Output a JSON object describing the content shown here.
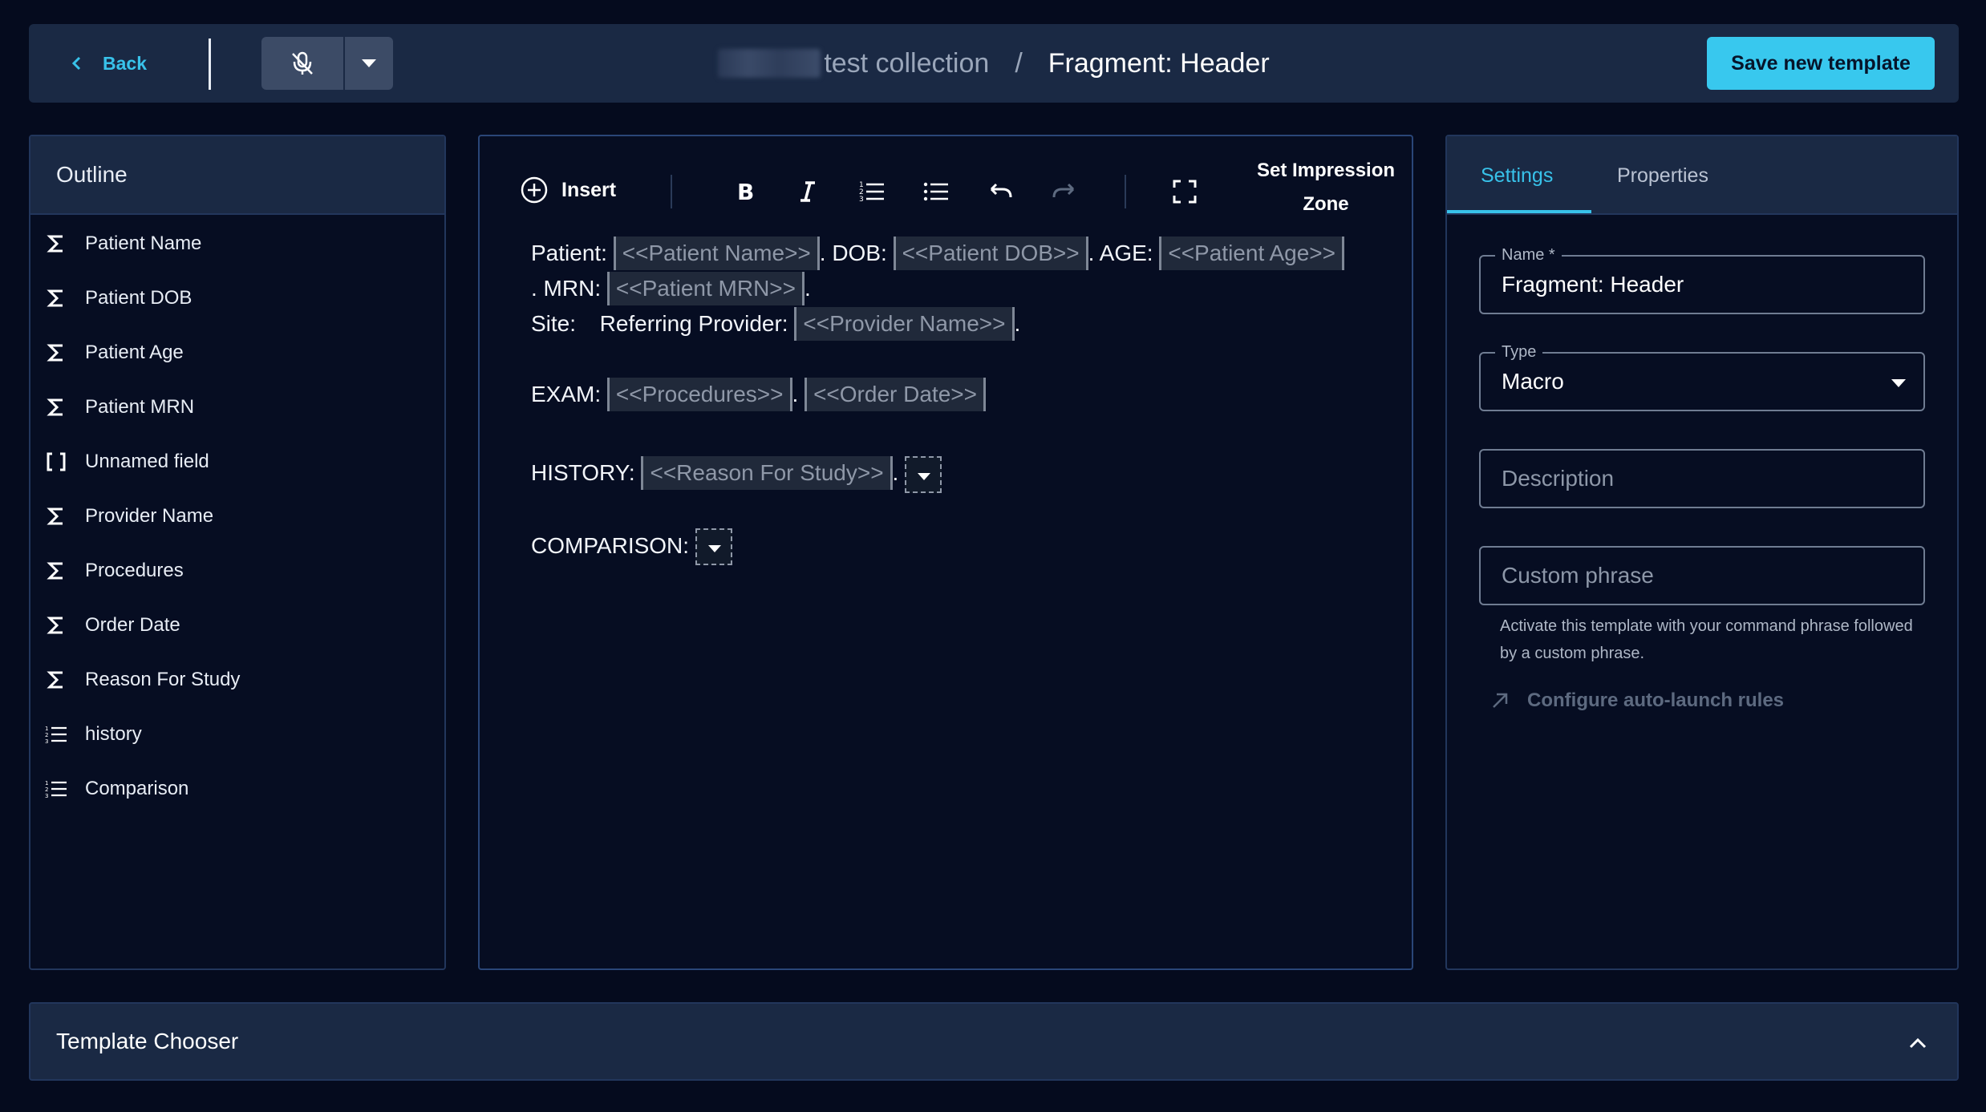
{
  "header": {
    "back_label": "Back",
    "collection": "test collection",
    "separator": "/",
    "current": "Fragment: Header",
    "save_label": "Save new template"
  },
  "outline": {
    "title": "Outline",
    "items": [
      {
        "label": "Patient Name",
        "icon": "sigma-icon"
      },
      {
        "label": "Patient DOB",
        "icon": "sigma-icon"
      },
      {
        "label": "Patient Age",
        "icon": "sigma-icon"
      },
      {
        "label": "Patient MRN",
        "icon": "sigma-icon"
      },
      {
        "label": "Unnamed field",
        "icon": "brackets-icon"
      },
      {
        "label": "Provider Name",
        "icon": "sigma-icon"
      },
      {
        "label": "Procedures",
        "icon": "sigma-icon"
      },
      {
        "label": "Order Date",
        "icon": "sigma-icon"
      },
      {
        "label": "Reason For Study",
        "icon": "sigma-icon"
      },
      {
        "label": "history",
        "icon": "list-icon"
      },
      {
        "label": "Comparison",
        "icon": "list-icon"
      }
    ]
  },
  "editor": {
    "insert_label": "Insert",
    "impression_line1": "Set Impression",
    "impression_line2": "Zone",
    "doc": {
      "patient": "Patient:",
      "patient_name": "<<Patient Name>>",
      "dob": ". DOB:",
      "patient_dob": "<<Patient DOB>>",
      "age": ". AGE:",
      "patient_age": "<<Patient Age>>",
      "mrn": ". MRN:",
      "patient_mrn": "<<Patient MRN>>",
      "period": ".",
      "site": "Site:",
      "referring": "Referring Provider:",
      "provider_name": "<<Provider Name>>",
      "exam": "EXAM:",
      "procedures": "<<Procedures>>",
      "order_date": "<<Order Date>>",
      "history": "HISTORY:",
      "reason": "<<Reason For Study>>",
      "comparison": "COMPARISON:"
    }
  },
  "settings": {
    "tab_settings": "Settings",
    "tab_properties": "Properties",
    "name_label": "Name *",
    "name_value": "Fragment: Header",
    "type_label": "Type",
    "type_value": "Macro",
    "description_placeholder": "Description",
    "custom_phrase_placeholder": "Custom phrase",
    "helper_text": "Activate this template with your command phrase followed by a custom phrase.",
    "auto_launch_label": "Configure auto-launch rules"
  },
  "footer": {
    "chooser_label": "Template Chooser"
  },
  "colors": {
    "accent": "#38c2ea",
    "background": "#050b1e",
    "panel_header": "#1a2944",
    "save_button": "#38c8ee"
  }
}
